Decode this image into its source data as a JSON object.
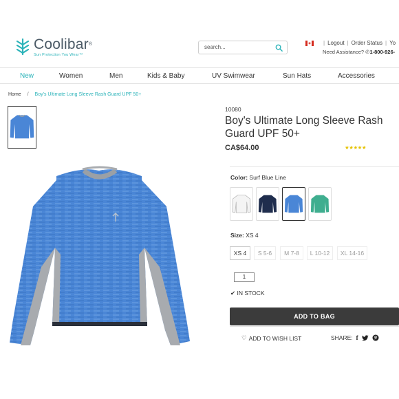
{
  "brand": {
    "name": "Coolibar",
    "registered": "®",
    "tagline": "Sun Protection You Wear™",
    "accent": "#2bb3b9"
  },
  "search": {
    "placeholder": "search..."
  },
  "utility": {
    "logout": "Logout",
    "order_status": "Order Status",
    "more": "Yo",
    "assistance": "Need Assistance?",
    "phone": "1-800-926-"
  },
  "nav": {
    "items": [
      "New",
      "Women",
      "Men",
      "Kids & Baby",
      "UV Swimwear",
      "Sun Hats",
      "Accessories"
    ],
    "active": "New"
  },
  "breadcrumb": {
    "home": "Home",
    "current": "Boy's Ultimate Long Sleeve Rash Guard UPF 50+"
  },
  "product": {
    "sku": "10080",
    "title": "Boy's Ultimate Long Sleeve Rash Guard UPF 50+",
    "price": "CA$64.00",
    "rating_stars": "★★★★★",
    "color_label": "Color:",
    "color_value": "Surf Blue Line",
    "colors": [
      {
        "name": "white",
        "hex": "#f2f2f2"
      },
      {
        "name": "navy",
        "hex": "#1f2d4d"
      },
      {
        "name": "surf-blue",
        "hex": "#4a86d6"
      },
      {
        "name": "green",
        "hex": "#3fae8f"
      }
    ],
    "selected_color_index": 2,
    "size_label": "Size:",
    "size_value": "XS 4",
    "sizes": [
      "XS 4",
      "S 5-6",
      "M 7-8",
      "L 10-12",
      "XL 14-16"
    ],
    "selected_size_index": 0,
    "quantity": "1",
    "stock": "IN STOCK",
    "add_to_bag": "ADD TO BAG",
    "wishlist": "ADD TO WISH LIST",
    "share_label": "SHARE:",
    "share_icons": [
      "f",
      "🐦",
      "P"
    ]
  }
}
